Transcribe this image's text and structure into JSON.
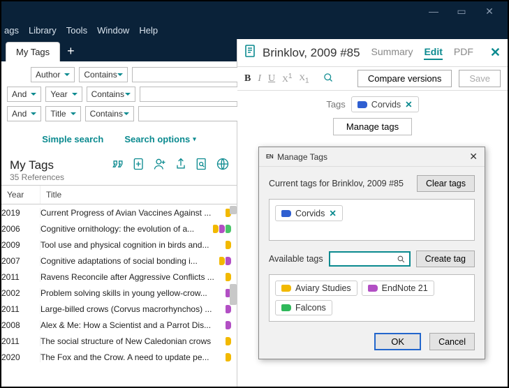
{
  "menubar": [
    "ags",
    "Library",
    "Tools",
    "Window",
    "Help"
  ],
  "tab": {
    "label": "My Tags"
  },
  "search": {
    "rows": [
      {
        "bool": "",
        "field": "Author",
        "op": "Contains"
      },
      {
        "bool": "And",
        "field": "Year",
        "op": "Contains"
      },
      {
        "bool": "And",
        "field": "Title",
        "op": "Contains"
      }
    ],
    "simple": "Simple search",
    "options": "Search options"
  },
  "list": {
    "title": "My Tags",
    "count": "35 References",
    "columns": {
      "year": "Year",
      "title": "Title"
    },
    "rows": [
      {
        "year": "2019",
        "title": "Current Progress of Avian Vaccines Against ...",
        "tags": [
          "#f2b900"
        ]
      },
      {
        "year": "2006",
        "title": "Cognitive ornithology: the evolution of a...",
        "tags": [
          "#f2b900",
          "#b24fc4",
          "#4bc46a"
        ]
      },
      {
        "year": "2009",
        "title": "Tool use and physical cognition in birds and...",
        "tags": [
          "#f2b900"
        ]
      },
      {
        "year": "2007",
        "title": "Cognitive adaptations of social bonding i...",
        "tags": [
          "#f2b900",
          "#b24fc4"
        ]
      },
      {
        "year": "2011",
        "title": "Ravens Reconcile after Aggressive Conflicts ...",
        "tags": [
          "#f2b900"
        ]
      },
      {
        "year": "2002",
        "title": "Problem solving skills in young yellow-crow...",
        "tags": [
          "#b24fc4"
        ]
      },
      {
        "year": "2011",
        "title": "Large-billed crows (Corvus macrorhynchos) ...",
        "tags": [
          "#b24fc4"
        ]
      },
      {
        "year": "2008",
        "title": "Alex & Me: How a Scientist and a Parrot Dis...",
        "tags": [
          "#b24fc4"
        ]
      },
      {
        "year": "2011",
        "title": "The social structure of New Caledonian crows",
        "tags": [
          "#f2b900"
        ]
      },
      {
        "year": "2020",
        "title": "The Fox and the Crow. A need to update pe...",
        "tags": [
          "#f2b900"
        ]
      }
    ]
  },
  "ref": {
    "title": "Brinklov, 2009 #85",
    "tabs": {
      "summary": "Summary",
      "edit": "Edit",
      "pdf": "PDF"
    },
    "compare": "Compare versions",
    "save": "Save",
    "tags_label": "Tags",
    "current_tag": {
      "name": "Corvids",
      "color": "#2f5fd1"
    },
    "manage": "Manage tags"
  },
  "dialog": {
    "title": "Manage Tags",
    "current_label": "Current tags for Brinklov, 2009 #85",
    "clear": "Clear tags",
    "current": [
      {
        "name": "Corvids",
        "color": "#2f5fd1"
      }
    ],
    "available_label": "Available tags",
    "create": "Create tag",
    "available": [
      {
        "name": "Aviary Studies",
        "color": "#f2b900"
      },
      {
        "name": "EndNote 21",
        "color": "#b24fc4"
      },
      {
        "name": "Falcons",
        "color": "#2fb85a"
      }
    ],
    "ok": "OK",
    "cancel": "Cancel"
  }
}
